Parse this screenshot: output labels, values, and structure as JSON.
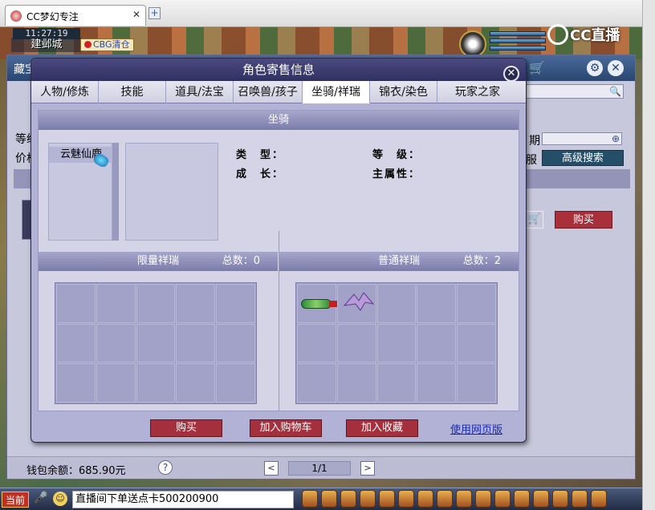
{
  "browser": {
    "tab_title": "CC梦幻专注",
    "tab_close": "✕",
    "new_tab": "+"
  },
  "game": {
    "clock": "11:27:19",
    "location": "建邺城",
    "cbg_badge": "CBG清仓",
    "cc_logo": "CC直播"
  },
  "cbg": {
    "header_title": "藏宝",
    "left_labels": [
      "等级",
      "价格"
    ],
    "date_label": "期",
    "server_label": "服",
    "advanced_search": "高级搜索",
    "buy": "购买",
    "wallet": "钱包余额：685.90元",
    "help": "?",
    "pagination": "1/1",
    "prev": "<",
    "next": ">"
  },
  "modal": {
    "title": "角色寄售信息",
    "tabs": [
      {
        "label": "人物/修炼",
        "active": false
      },
      {
        "label": "技能",
        "active": false
      },
      {
        "label": "道具/法宝",
        "active": false
      },
      {
        "label": "召唤兽/孩子",
        "active": false
      },
      {
        "label": "坐骑/祥瑞",
        "active": true
      },
      {
        "label": "锦衣/染色",
        "active": false
      },
      {
        "label": "玩家之家",
        "active": false
      }
    ],
    "mount_section": "坐骑",
    "mount_item": "云魅仙鹿",
    "attrs": {
      "type": "类　型：",
      "grade": "等　级：",
      "growth": "成　长：",
      "main_attr": "主属性："
    },
    "limited_title": "限量祥瑞",
    "limited_total": "总数：0",
    "normal_title": "普通祥瑞",
    "normal_total": "总数：2",
    "buttons": {
      "buy": "购买",
      "add_cart": "加入购物车",
      "add_fav": "加入收藏",
      "web": "使用网页版"
    }
  },
  "bottom": {
    "current": "当前",
    "chat_text": "直播间下单送点卡500200900"
  },
  "colors": {
    "modal_bg": "#b2b2d6",
    "accent_red": "#a3303c",
    "header_blue": "#303062"
  }
}
